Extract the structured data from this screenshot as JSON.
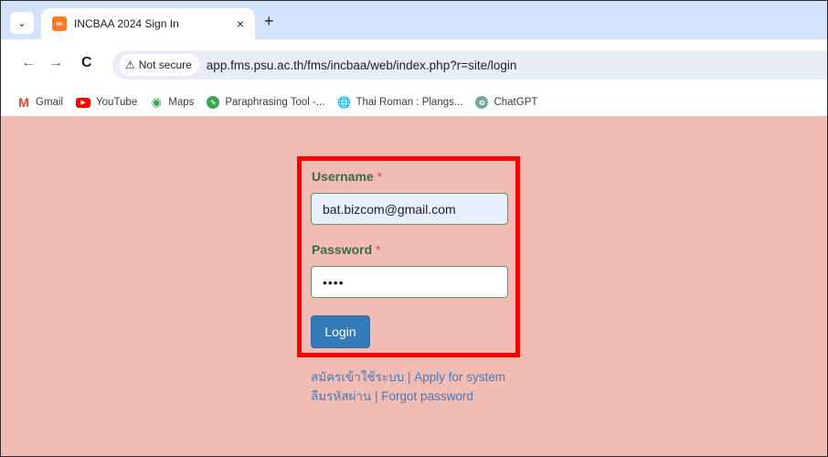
{
  "browser": {
    "tab": {
      "title": "INCBAA 2024 Sign In",
      "close": "×",
      "favicon": "xampp-favicon"
    },
    "new_tab": "+",
    "toolbar": {
      "back": "←",
      "forward": "→",
      "reload": "C",
      "security_warning": "Not secure",
      "url": "app.fms.psu.ac.th/fms/incbaa/web/index.php?r=site/login"
    },
    "bookmarks": [
      {
        "label": "Gmail",
        "icon": "gmail-icon"
      },
      {
        "label": "YouTube",
        "icon": "youtube-icon"
      },
      {
        "label": "Maps",
        "icon": "maps-icon"
      },
      {
        "label": "Paraphrasing Tool -...",
        "icon": "paraphrasing-icon"
      },
      {
        "label": "Thai Roman : Plangs...",
        "icon": "globe-icon"
      },
      {
        "label": "ChatGPT",
        "icon": "chatgpt-icon"
      }
    ]
  },
  "login_form": {
    "username_label": "Username",
    "username_value": "bat.bizcom@gmail.com",
    "password_label": "Password",
    "password_value": "••••",
    "required_mark": "*",
    "login_button": "Login",
    "signup_link": "สมัครเข้าใช้ระบบ | Apply for system",
    "forgot_link": "ลืมรหัสผ่าน | Forgot password"
  },
  "colors": {
    "page_background": "#f0bcb3",
    "highlight_border": "#ff0000",
    "label_green": "#3c6b3c",
    "button_blue": "#337ab7",
    "link_blue": "#4a78b8"
  }
}
